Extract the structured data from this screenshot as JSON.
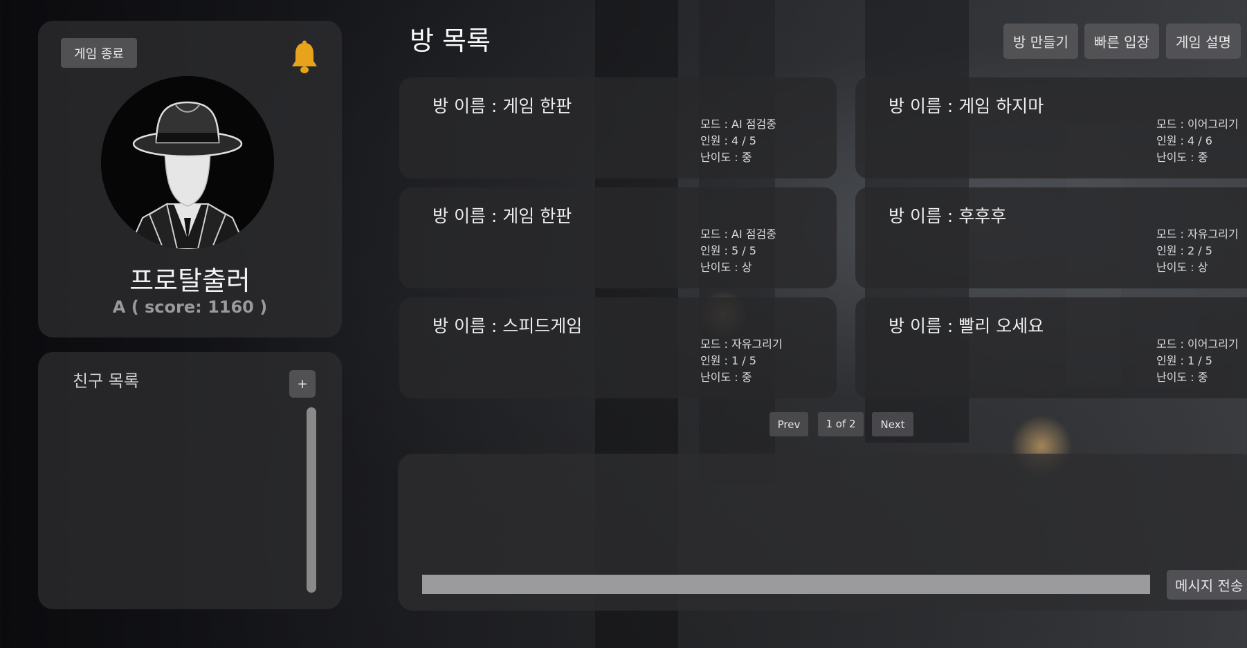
{
  "profile": {
    "exit_button": "게임 종료",
    "bell_icon": "bell-icon",
    "bell_color": "#e8a31c",
    "nickname": "프로탈출러",
    "rank": "A ( score: 1160 )"
  },
  "friends": {
    "title": "친구 목록",
    "add_button": "+"
  },
  "header": {
    "title": "방 목록",
    "create_room": "방 만들기",
    "quick_join": "빠른 입장",
    "game_help": "게임 설명"
  },
  "rooms": [
    {
      "name": "방 이름 : 게임 한판",
      "mode": "모드 : AI 점검중",
      "players": "인원 : 4 / 5",
      "difficulty": "난이도 : 중"
    },
    {
      "name": "방 이름 : 게임 하지마",
      "mode": "모드 : 이어그리기",
      "players": "인원 : 4 / 6",
      "difficulty": "난이도 : 중"
    },
    {
      "name": "방 이름 : 게임 한판",
      "mode": "모드 : AI 점검중",
      "players": "인원 : 5 / 5",
      "difficulty": "난이도 : 상"
    },
    {
      "name": "방 이름 : 후후후",
      "mode": "모드 : 자유그리기",
      "players": "인원 : 2 / 5",
      "difficulty": "난이도 : 상"
    },
    {
      "name": "방 이름 : 스피드게임",
      "mode": "모드 : 자유그리기",
      "players": "인원 : 1 / 5",
      "difficulty": "난이도 : 중"
    },
    {
      "name": "방 이름 : 빨리 오세요",
      "mode": "모드 : 이어그리기",
      "players": "인원 : 1 / 5",
      "difficulty": "난이도 : 중"
    }
  ],
  "pagination": {
    "prev": "Prev",
    "indicator": "1 of 2",
    "next": "Next"
  },
  "chat": {
    "input_value": "",
    "send_button": "메시지 전송"
  }
}
